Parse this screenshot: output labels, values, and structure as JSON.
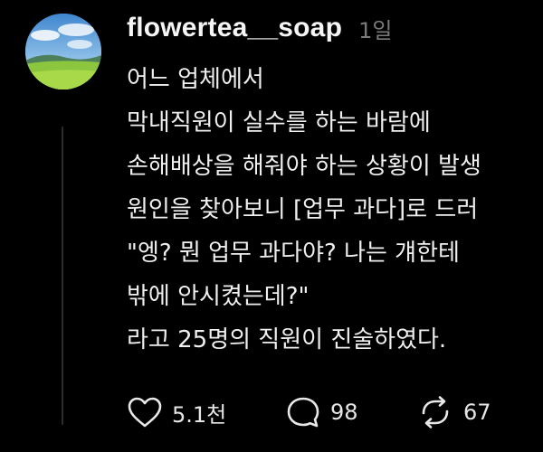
{
  "post": {
    "username": "flowertea__soap",
    "timestamp": "1일",
    "lines": [
      "어느 업체에서",
      "막내직원이 실수를 하는 바람에",
      "손해배상을 해줘야 하는 상황이 발생",
      "원인을 찾아보니 [업무 과다]로 드러",
      "\"엥? 뭔 업무 과다야? 나는 걔한테",
      "밖에 안시켰는데?\"",
      "라고 25명의 직원이 진술하였다."
    ],
    "actions": {
      "likes": {
        "icon": "heart-icon",
        "count": "5.1천"
      },
      "replies": {
        "icon": "comment-bubble-icon",
        "count": "98"
      },
      "reposts": {
        "icon": "repost-icon",
        "count": "67"
      }
    }
  },
  "colors": {
    "background": "#000000",
    "text": "#efefef",
    "muted": "#7a7a7a"
  }
}
